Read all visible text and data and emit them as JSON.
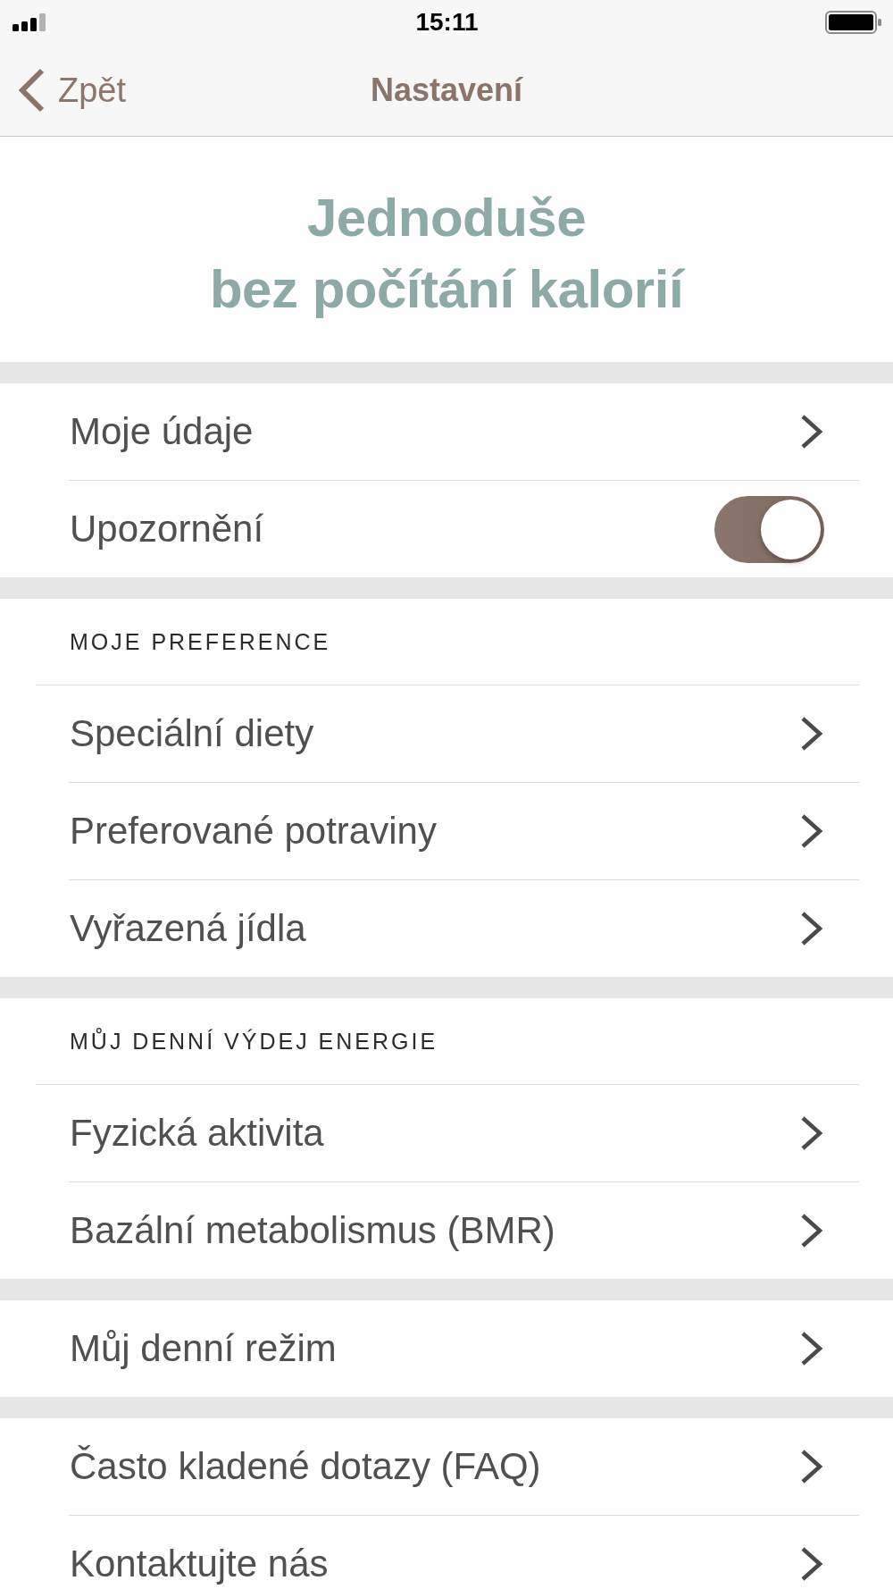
{
  "status_bar": {
    "time": "15:11"
  },
  "nav_bar": {
    "back_label": "Zpět",
    "title": "Nastavení"
  },
  "hero": {
    "heading": "Jednoduše\nbez počítání kalorií"
  },
  "groups": [
    {
      "items": [
        {
          "kind": "link",
          "label": "Moje údaje"
        },
        {
          "kind": "toggle",
          "label": "Upozornění",
          "on": true
        }
      ]
    },
    {
      "header": "MOJE PREFERENCE",
      "items": [
        {
          "kind": "link",
          "label": "Speciální diety"
        },
        {
          "kind": "link",
          "label": "Preferované potraviny"
        },
        {
          "kind": "link",
          "label": "Vyřazená jídla"
        }
      ]
    },
    {
      "header": "MŮJ DENNÍ VÝDEJ ENERGIE",
      "items": [
        {
          "kind": "link",
          "label": "Fyzická aktivita"
        },
        {
          "kind": "link",
          "label": "Bazální metabolismus (BMR)"
        }
      ]
    },
    {
      "items": [
        {
          "kind": "link",
          "label": "Můj denní režim"
        }
      ]
    },
    {
      "items": [
        {
          "kind": "link",
          "label": "Často kladené dotazy (FAQ)"
        },
        {
          "kind": "link",
          "label": "Kontaktujte nás"
        }
      ]
    }
  ]
}
